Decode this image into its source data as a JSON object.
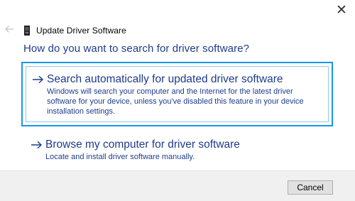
{
  "window": {
    "title": "Update Driver Software",
    "close_glyph": "✕"
  },
  "question": "How do you want to search for driver software?",
  "options": [
    {
      "title": "Search automatically for updated driver software",
      "description": "Windows will search your computer and the Internet for the latest driver software for your device, unless you've disabled this feature in your device installation settings.",
      "focused": true
    },
    {
      "title": "Browse my computer for driver software",
      "description": "Locate and install driver software manually.",
      "focused": false
    }
  ],
  "footer": {
    "cancel_label": "Cancel"
  },
  "icons": {
    "back": "back-arrow-icon",
    "device": "device-icon",
    "close": "close-icon",
    "option_arrow": "right-arrow-icon"
  },
  "colors": {
    "accent_text": "#1e3c8c",
    "focus_border": "#1796e6",
    "footer_bg": "#f0f0f0"
  }
}
